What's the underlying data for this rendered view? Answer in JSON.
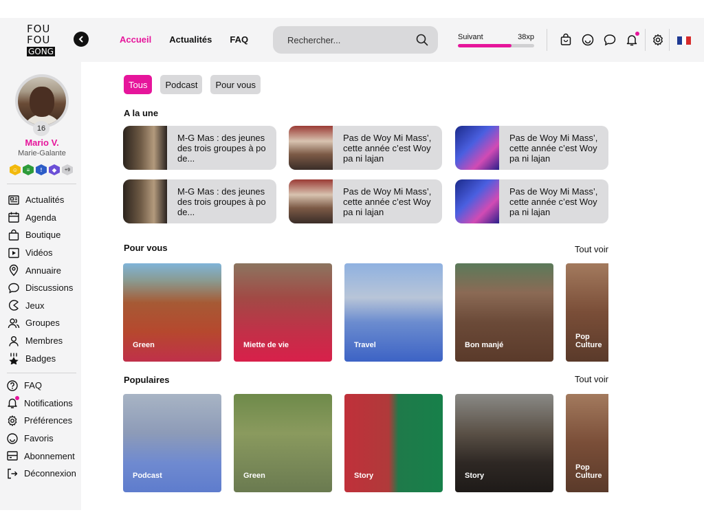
{
  "logo": {
    "line1": "FOU",
    "line2": "FOU",
    "line3": "GONG"
  },
  "nav": {
    "home": "Accueil",
    "news": "Actualités",
    "faq": "FAQ"
  },
  "search": {
    "placeholder": "Rechercher..."
  },
  "xp": {
    "label": "Suivant",
    "value": "38xp",
    "progress": 0.7
  },
  "colors": {
    "accent": "#e6159b"
  },
  "user": {
    "name": "Mario V.",
    "location": "Marie-Galante",
    "level": "16",
    "badges_more": "+9"
  },
  "menu_main": [
    {
      "label": "Actualités",
      "icon": "newspaper-icon"
    },
    {
      "label": "Agenda",
      "icon": "calendar-icon"
    },
    {
      "label": "Boutique",
      "icon": "shopping-bag-icon"
    },
    {
      "label": "Vidéos",
      "icon": "video-icon"
    },
    {
      "label": "Annuaire",
      "icon": "location-pin-icon"
    },
    {
      "label": "Discussions",
      "icon": "chat-bubble-icon"
    },
    {
      "label": "Jeux",
      "icon": "pacman-icon"
    },
    {
      "label": "Groupes",
      "icon": "group-icon"
    },
    {
      "label": "Membres",
      "icon": "user-icon"
    },
    {
      "label": "Badges",
      "icon": "medal-icon"
    }
  ],
  "menu_secondary": [
    {
      "label": "FAQ",
      "icon": "help-icon"
    },
    {
      "label": "Notifications",
      "icon": "bell-icon"
    },
    {
      "label": "Préférences",
      "icon": "gear-icon"
    },
    {
      "label": "Favoris",
      "icon": "smiley-icon"
    },
    {
      "label": "Abonnement",
      "icon": "subscription-icon"
    },
    {
      "label": "Déconnexion",
      "icon": "logout-icon"
    }
  ],
  "filters": [
    "Tous",
    "Podcast",
    "Pour vous"
  ],
  "headlines": {
    "title": "A la une",
    "items": [
      {
        "text": "M-G Mas : des jeunes des trois groupes à po de..."
      },
      {
        "text": "Pas de Woy Mi Mass’, cette année c’est Woy pa ni lajan"
      },
      {
        "text": "Pas de Woy Mi Mass’, cette année c’est Woy pa ni lajan"
      },
      {
        "text": "M-G Mas : des jeunes des trois groupes à po de..."
      },
      {
        "text": "Pas de Woy Mi Mass’, cette année c’est Woy pa ni lajan"
      },
      {
        "text": "Pas de Woy Mi Mass’, cette année c’est Woy pa ni lajan"
      }
    ]
  },
  "for_you": {
    "title": "Pour vous",
    "see_all": "Tout voir",
    "cards": [
      {
        "label": "Green"
      },
      {
        "label": "Miette de vie"
      },
      {
        "label": "Travel"
      },
      {
        "label": "Bon manjé"
      },
      {
        "label": "Pop Culture"
      }
    ]
  },
  "popular": {
    "title": "Populaires",
    "see_all": "Tout voir",
    "cards": [
      {
        "label": "Podcast"
      },
      {
        "label": "Green"
      },
      {
        "label": "Story"
      },
      {
        "label": "Story"
      },
      {
        "label": "Pop Culture"
      }
    ]
  }
}
